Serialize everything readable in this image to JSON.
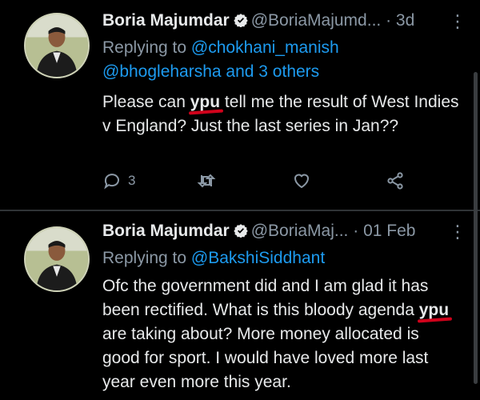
{
  "tweets": [
    {
      "name": "Boria Majumdar",
      "handle": "@BoriaMajumd...",
      "time": "3d",
      "reply_prefix": "Replying to",
      "reply_mention_1": "@chokhani_manish",
      "reply_mention_2": "@bhogleharsha and 3 others",
      "body_1": "Please can ",
      "body_highlight": "ypu",
      "body_2": " tell me the result of West Indies v England? Just the last series in Jan??",
      "replies": "3"
    },
    {
      "name": "Boria Majumdar",
      "handle": "@BoriaMaj...",
      "time": "01 Feb",
      "reply_prefix": "Replying to",
      "reply_mention_1": "@BakshiSiddhant",
      "body_1": "Ofc the government did and I am glad it has been rectified. What is this bloody agenda ",
      "body_highlight": "ypu",
      "body_2": " are taking about? More money allocated is good for sport. I would have loved more last year even more this year."
    }
  ],
  "icons": {
    "verified_color": "#e7e9ea",
    "mention_color": "#1d9bf0",
    "underline_color": "#d0021b"
  }
}
